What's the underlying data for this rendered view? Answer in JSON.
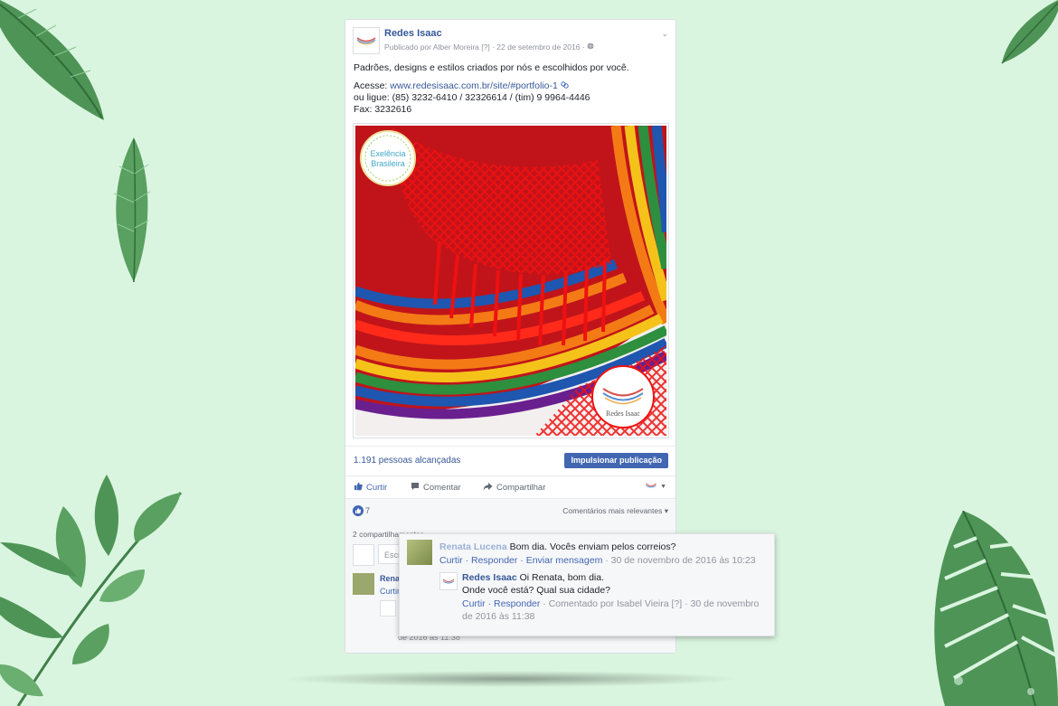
{
  "post": {
    "page_name": "Redes Isaac",
    "published_by": "Publicado por Alber Moreira",
    "help_marker": "[?]",
    "date": "· 22 de setembro de 2016 ·",
    "line1": "Padrões, designs e estilos criados por nós e escolhidos por você.",
    "acesse_label": "Acesse: ",
    "url": "www.redesisaac.com.br/site/#portfolio-1",
    "phone_line": "ou ligue: (85) 3232-6410 / 32326614 / (tim) 9 9964-4446",
    "fax_line": "Fax: 3232616"
  },
  "image": {
    "badge_line1": "Exelência",
    "badge_line2": "Brasileira",
    "logo_text": "Redes Isaac"
  },
  "reach": {
    "text": "1.191 pessoas alcançadas",
    "boost_label": "Impulsionar publicação"
  },
  "actions": {
    "like": "Curtir",
    "comment": "Comentar",
    "share": "Compartilhar"
  },
  "reactions": {
    "count": "7",
    "relevance": "Comentários mais relevantes ▾"
  },
  "shares_text": "2 compartilhamentos",
  "comment_input_placeholder": "Escr",
  "comment1": {
    "author": "Renata Lucena",
    "text": " Bom dia. Vocês enviam pelos correios?",
    "actions": "Curtir · Responder · Enviar mensagem",
    "date": " · 30 de novembro de 2016 às 10:23"
  },
  "reply1": {
    "author": "Redes Isaac",
    "text1": " Oi Renata, bom dia.",
    "text2": "Onde você está? Qual sua cidade?",
    "actions": "Curtir · Responder",
    "meta": " · Comentado por Isabel Vieira [?] · 30 de novembro de 2016 às 11:38"
  },
  "behind": {
    "name": "Rena",
    "curtir": "Curtir",
    "date_fragment": "de 2016 às 11:38"
  },
  "colors": {
    "background": "#d9f5df",
    "link": "#365899",
    "boost": "#4267b2"
  }
}
